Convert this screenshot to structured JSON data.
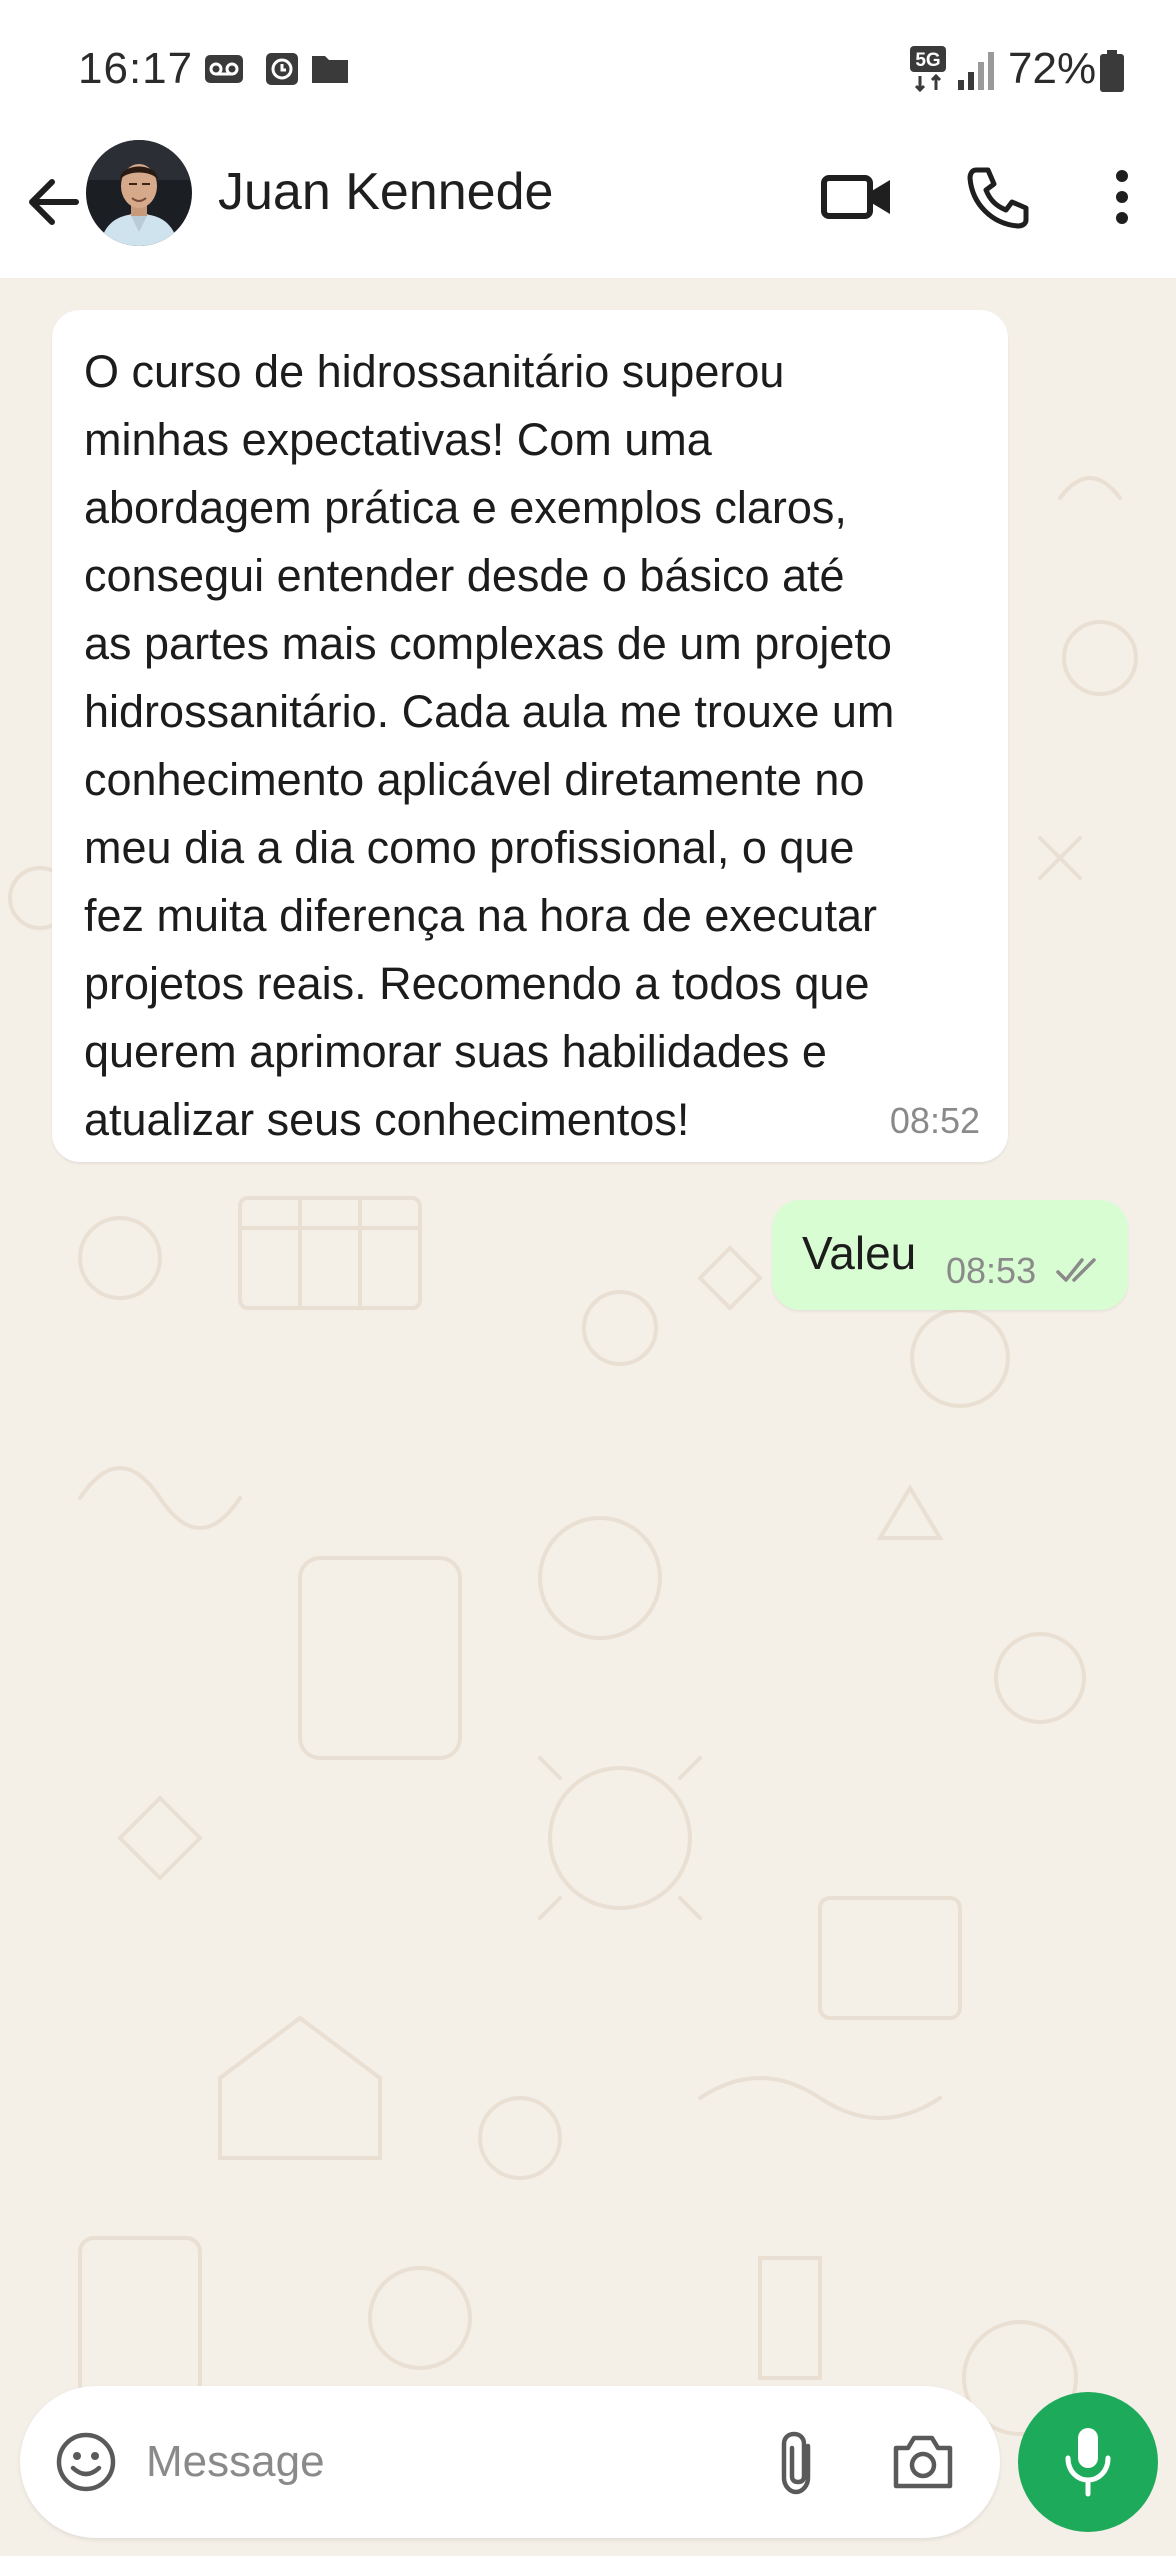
{
  "status_bar": {
    "time": "16:17",
    "battery_percent": "72%",
    "network": "5G"
  },
  "header": {
    "contact_name": "Juan Kennede",
    "icons": [
      "back-arrow-icon",
      "video-call-icon",
      "phone-icon",
      "more-vert-icon"
    ]
  },
  "messages": [
    {
      "direction": "incoming",
      "text": "O curso de hidrossanitário superou\nminhas expectativas! Com uma\nabordagem prática e exemplos claros,\nconsegui entender desde o básico até\nas partes mais complexas de um projeto\nhidrossanitário. Cada aula me trouxe um\nconhecimento aplicável diretamente no\nmeu dia a dia como profissional, o que\nfez muita diferença na hora de executar\nprojetos reais. Recomendo a todos que\nquerem aprimorar suas habilidades e\natualizar seus conhecimentos!",
      "time": "08:52"
    },
    {
      "direction": "outgoing",
      "text": "Valeu",
      "time": "08:53",
      "status": "delivered"
    }
  ],
  "composer": {
    "placeholder": "Message",
    "value": ""
  },
  "colors": {
    "chat_background": "#f4efe7",
    "outgoing_bubble": "#d9fdd3",
    "incoming_bubble": "#ffffff",
    "mic_button": "#1eaa5b"
  }
}
